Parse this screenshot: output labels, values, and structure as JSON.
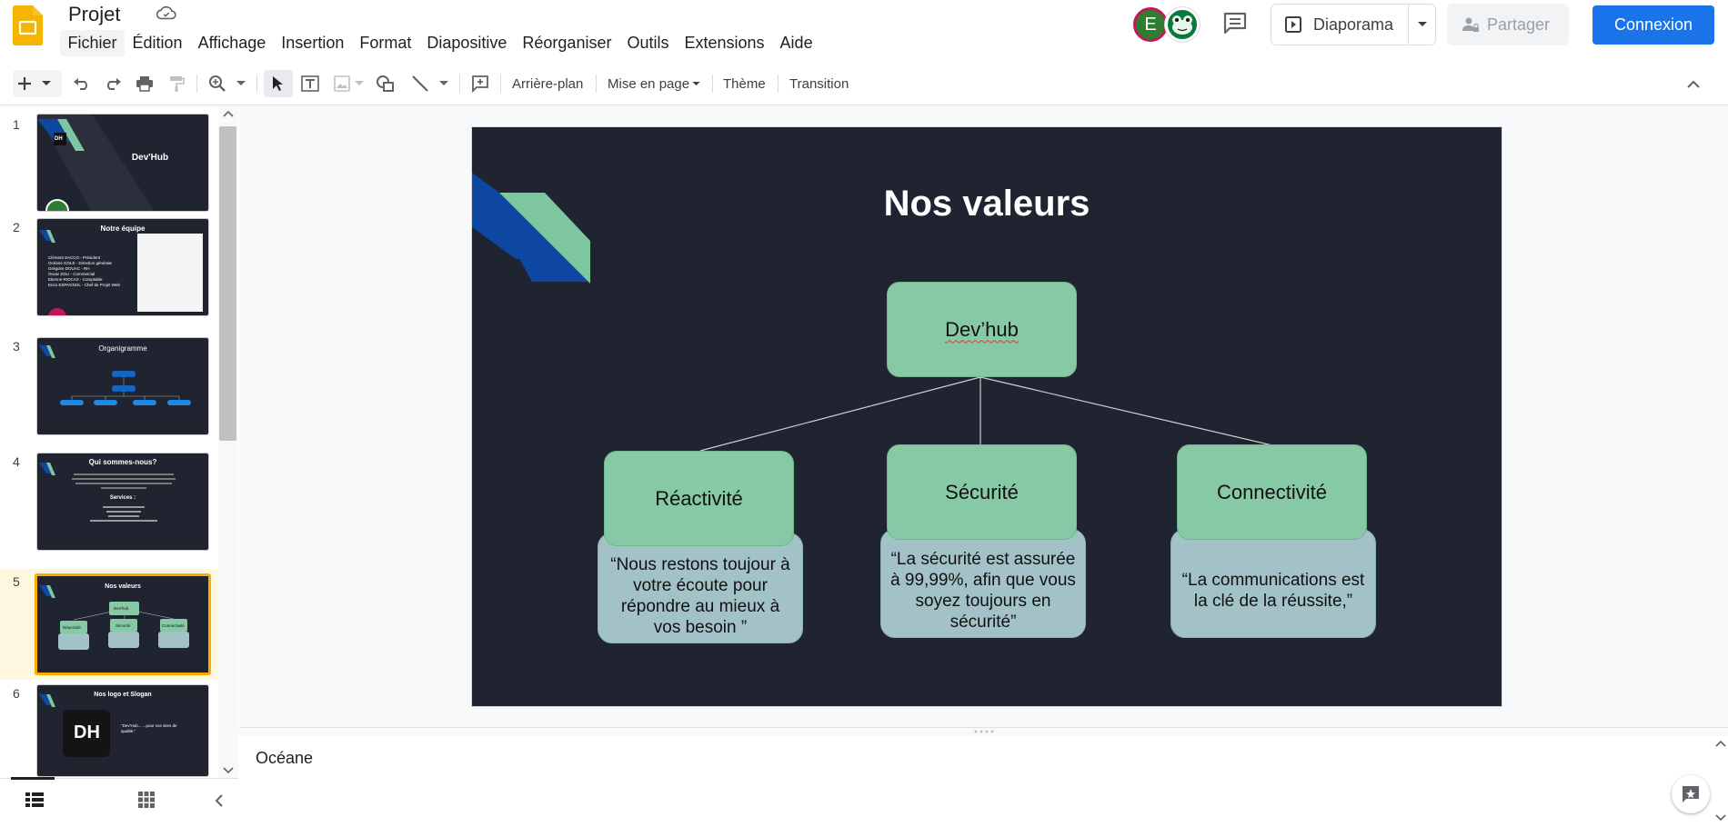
{
  "app": {
    "document_title": "Projet",
    "menu": [
      "Fichier",
      "Édition",
      "Affichage",
      "Insertion",
      "Format",
      "Diapositive",
      "Réorganiser",
      "Outils",
      "Extensions",
      "Aide"
    ],
    "avatar_initial": "E",
    "present_label": "Diaporama",
    "share_label": "Partager",
    "login_label": "Connexion"
  },
  "toolbar": {
    "background_label": "Arrière-plan",
    "layout_label": "Mise en page",
    "theme_label": "Thème",
    "transition_label": "Transition"
  },
  "filmstrip": {
    "active_index": 5,
    "slides": [
      {
        "num": "1",
        "title": "Dev'Hub",
        "logo": "DH"
      },
      {
        "num": "2",
        "title": "Notre équipe",
        "lines": [
          "Clément SACCO - Président",
          "Océane GOLE - Direction générale",
          "Grégoire DOUAC - RH",
          "Oscar ZOLI - Commercial",
          "Etienne RIOCAX - Comptable",
          "Enzo ESPAGNOL - Chef de Projet Web"
        ]
      },
      {
        "num": "3",
        "title": "Organigramme"
      },
      {
        "num": "4",
        "title": "Qui sommes-nous?",
        "subtitle": "Services :"
      },
      {
        "num": "5",
        "title": "Nos valeurs",
        "nodes": [
          "Dev'hub",
          "Réactivité",
          "Sécurité",
          "Connectivité"
        ]
      },
      {
        "num": "6",
        "title": "Nos logo et Slogan",
        "logo": "DH",
        "slogan": "\"Dev'Hub... ...pour vos sites de qualité.\""
      }
    ]
  },
  "slide": {
    "title": "Nos valeurs",
    "root": "Dev’hub",
    "values": [
      {
        "name": "Réactivité",
        "quote": "“Nous restons toujour à votre écoute pour répondre au mieux à vos besoin ”"
      },
      {
        "name": "Sécurité",
        "quote": "“La sécurité est assurée à 99,99%, afin que vous soyez toujours en sécurité”"
      },
      {
        "name": "Connectivité",
        "quote": "“La communications est la clé de la réussite,”"
      }
    ]
  },
  "notes": {
    "text": "Océane"
  },
  "colors": {
    "accent_blue": "#1a73e8",
    "slide_bg": "#1f2430",
    "node_green": "#86c9a4",
    "quote_blue": "#a3c2c8",
    "active_border": "#f9ab00"
  }
}
